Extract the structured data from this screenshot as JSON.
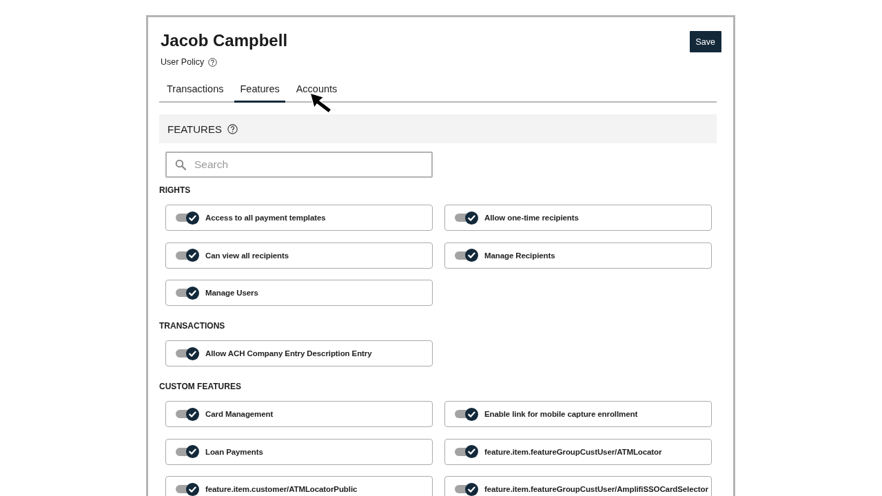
{
  "header": {
    "title": "Jacob Campbell",
    "subtitle": "User Policy",
    "save_button": "Save"
  },
  "tabs": [
    {
      "label": "Transactions",
      "selected": false
    },
    {
      "label": "Features",
      "selected": true
    },
    {
      "label": "Accounts",
      "selected": false
    }
  ],
  "panel": {
    "title": "FEATURES",
    "search": {
      "placeholder": "Search"
    },
    "groups": [
      {
        "title": "RIGHTS",
        "items": [
          {
            "label": "Access to all payment templates",
            "on": true
          },
          {
            "label": "Allow one-time recipients",
            "on": true
          },
          {
            "label": "Can view all recipients",
            "on": true
          },
          {
            "label": "Manage Recipients",
            "on": true
          },
          {
            "label": "Manage Users",
            "on": true
          }
        ]
      },
      {
        "title": "TRANSACTIONS",
        "items": [
          {
            "label": "Allow ACH Company Entry Description Entry",
            "on": true
          }
        ]
      },
      {
        "title": "CUSTOM FEATURES",
        "items": [
          {
            "label": "Card Management",
            "on": true
          },
          {
            "label": "Enable link for mobile capture enrollment",
            "on": true
          },
          {
            "label": "Loan Payments",
            "on": true
          },
          {
            "label": "feature.item.featureGroupCustUser/ATMLocator",
            "on": true
          },
          {
            "label": "feature.item.customer/ATMLocatorPublic",
            "on": true
          },
          {
            "label": "feature.item.featureGroupCustUser/AmplifiSSOCardSelector",
            "on": true
          }
        ]
      }
    ]
  }
}
